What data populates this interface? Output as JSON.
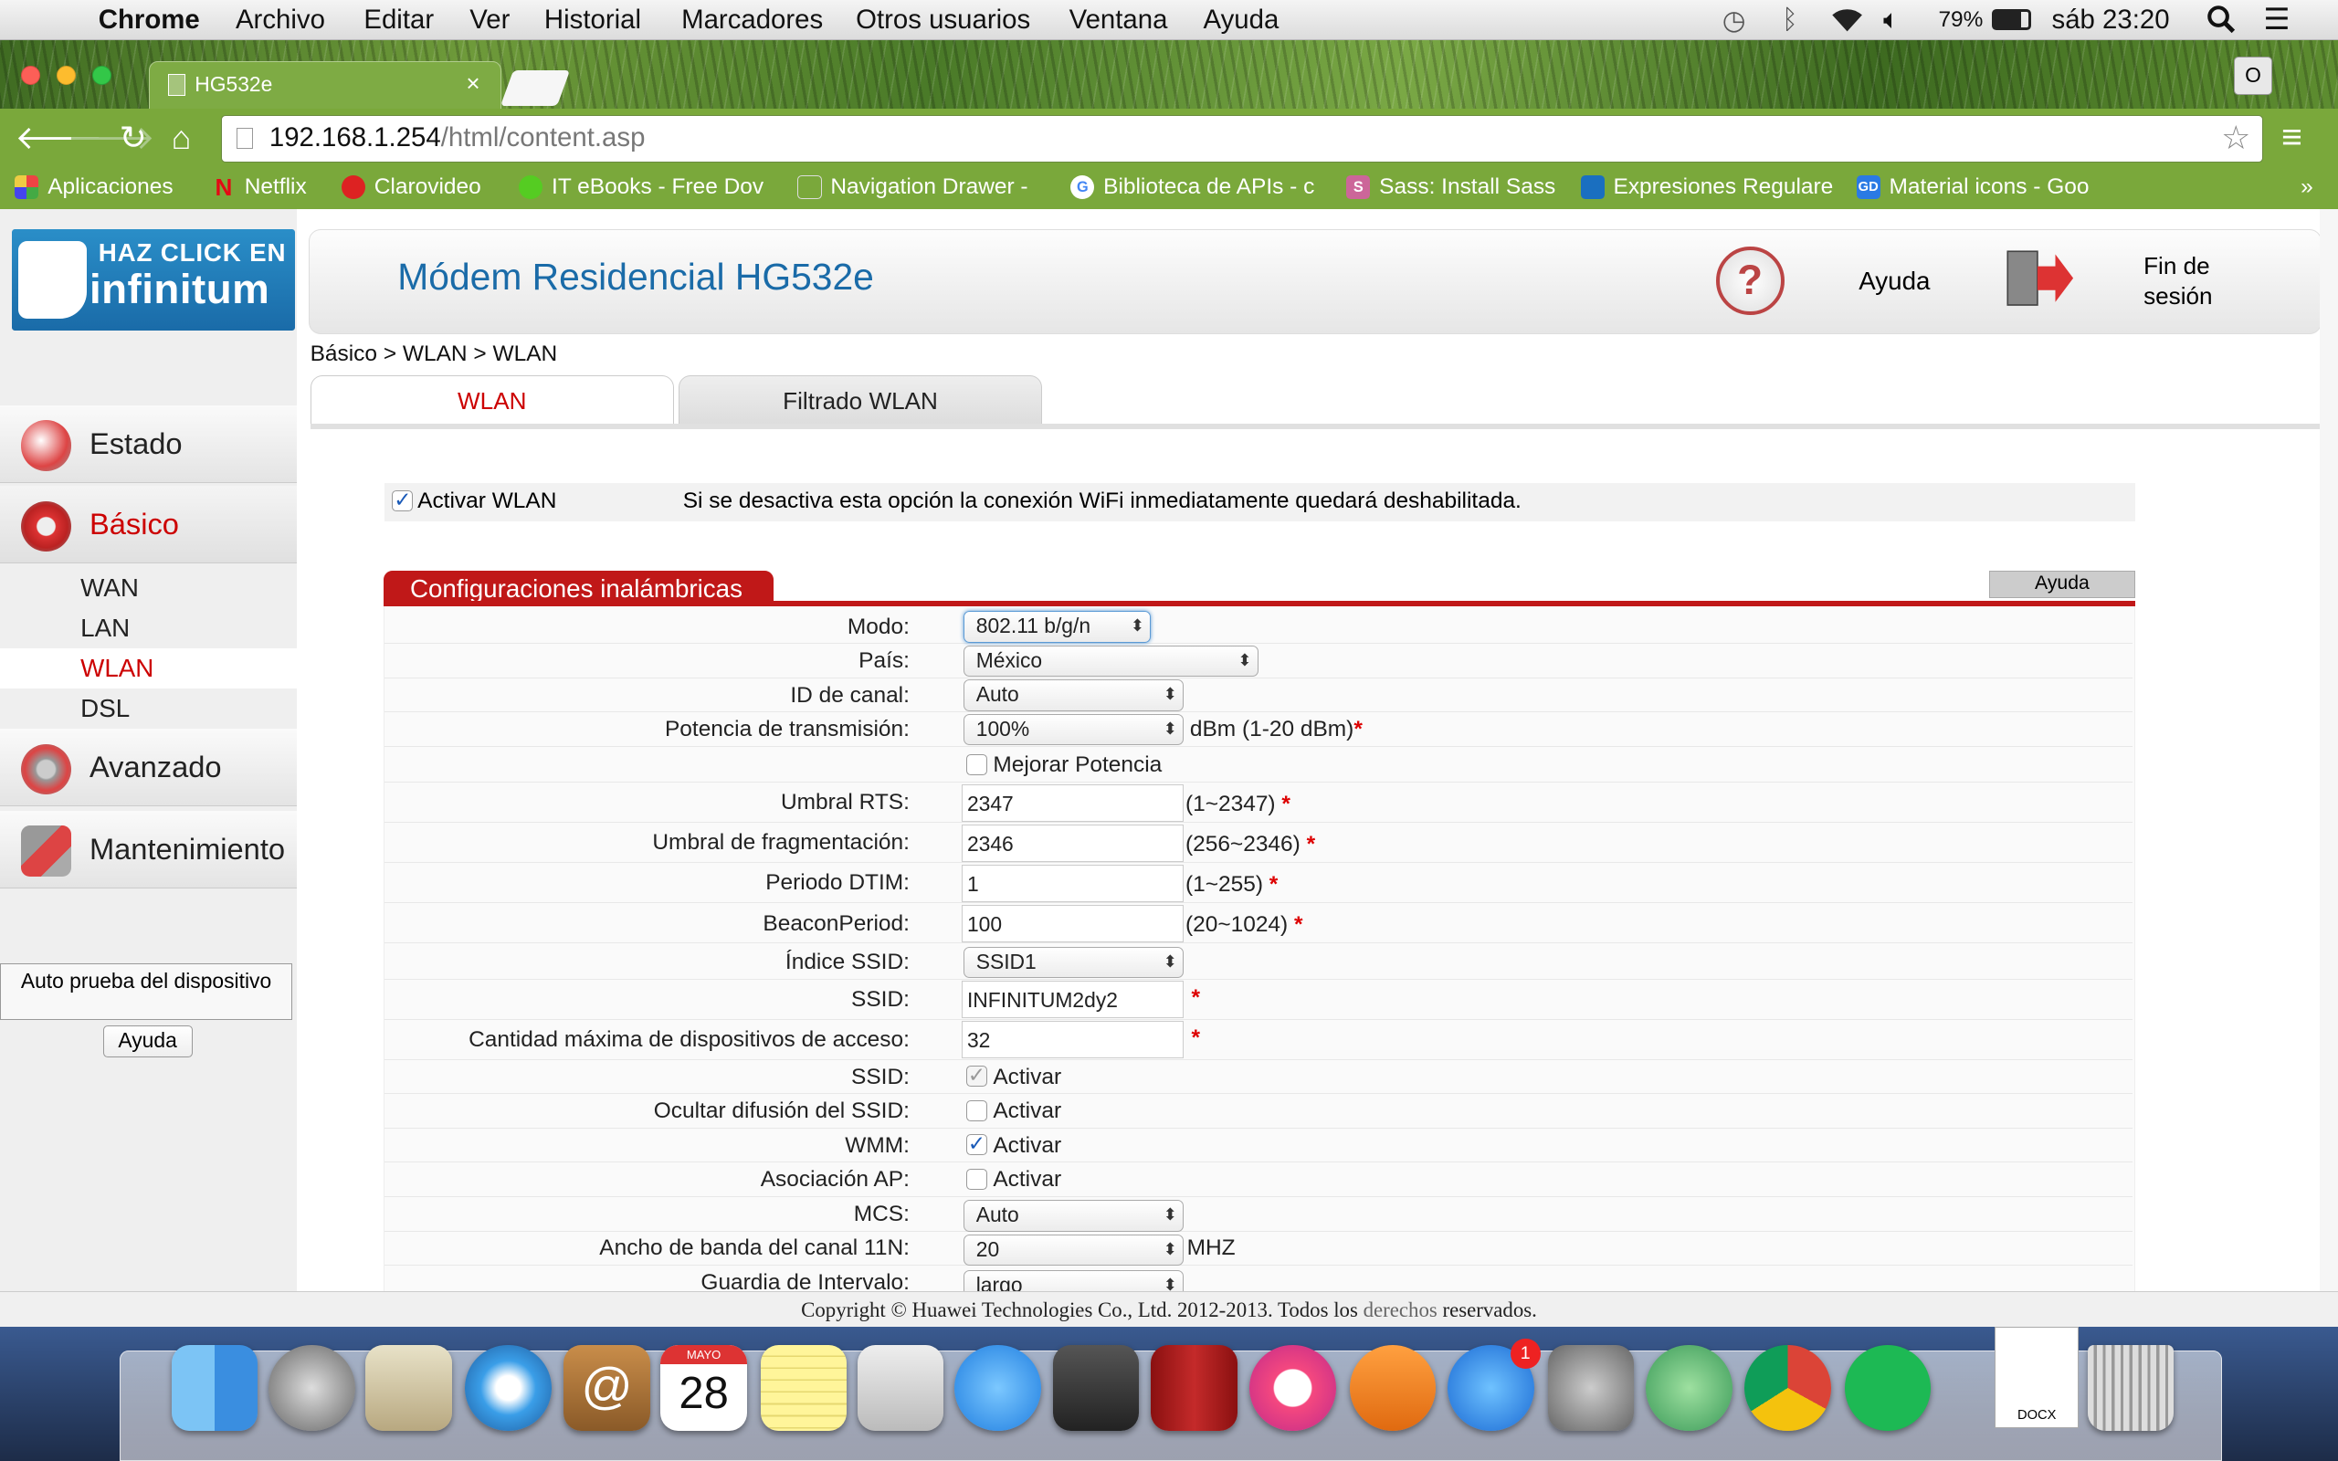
{
  "menubar": {
    "app": "Chrome",
    "items": [
      "Archivo",
      "Editar",
      "Ver",
      "Historial",
      "Marcadores",
      "Otros usuarios",
      "Ventana",
      "Ayuda"
    ],
    "battery": "79%",
    "clock": "sáb 23:20"
  },
  "browser": {
    "tab_title": "HG532e",
    "tab_close": "×",
    "profile": "O",
    "url_host": "192.168.1.254",
    "url_path": "/html/content.asp",
    "bookmarks": [
      "Aplicaciones",
      "Netflix",
      "Clarovideo",
      "IT eBooks - Free Dov",
      "Navigation Drawer -",
      "Biblioteca de APIs - c",
      "Sass: Install Sass",
      "Expresiones Regulare",
      "Material icons - Goo"
    ],
    "bookmarks_more": "»"
  },
  "logo": {
    "line1": "HAZ CLICK EN",
    "line2": "infinitum"
  },
  "header": {
    "title": "Módem Residencial HG532e",
    "help": "Ayuda",
    "logout": "Fin de sesión"
  },
  "sidebar": {
    "estado": "Estado",
    "basico": "Básico",
    "sub": [
      "WAN",
      "LAN",
      "WLAN",
      "DSL"
    ],
    "avanzado": "Avanzado",
    "mantenimiento": "Mantenimiento",
    "autotest": "Auto prueba del dispositivo",
    "help": "Ayuda"
  },
  "breadcrumb": "Básico > WLAN > WLAN",
  "tabs": [
    "WLAN",
    "Filtrado WLAN"
  ],
  "wlan": {
    "enable_label": "Activar WLAN",
    "enable_note": "Si se desactiva esta opción la conexión WiFi inmediatamente quedará deshabilitada."
  },
  "section": {
    "title": "Configuraciones inalámbricas",
    "help": "Ayuda"
  },
  "form": {
    "mode_label": "Modo:",
    "mode": "802.11 b/g/n",
    "country_label": "País:",
    "country": "México",
    "channel_label": "ID de canal:",
    "channel": "Auto",
    "power_label": "Potencia de transmisión:",
    "power": "100%",
    "power_unit": "dBm (1-20 dBm)",
    "boost_label": "Mejorar Potencia",
    "rts_label": "Umbral RTS:",
    "rts": "2347",
    "rts_range": "(1~2347)",
    "frag_label": "Umbral de fragmentación:",
    "frag": "2346",
    "frag_range": "(256~2346)",
    "dtim_label": "Periodo DTIM:",
    "dtim": "1",
    "dtim_range": "(1~255)",
    "beacon_label": "BeaconPeriod:",
    "beacon": "100",
    "beacon_range": "(20~1024)",
    "ssid_index_label": "Índice SSID:",
    "ssid_index": "SSID1",
    "ssid_label": "SSID:",
    "ssid": "INFINITUM2dy2",
    "maxdev_label": "Cantidad máxima de dispositivos de acceso:",
    "maxdev": "32",
    "ssid_enable_label": "SSID:",
    "activate": "Activar",
    "hide_label": "Ocultar difusión del SSID:",
    "wmm_label": "WMM:",
    "ap_label": "Asociación AP:",
    "mcs_label": "MCS:",
    "mcs": "Auto",
    "bw_label": "Ancho de banda del canal 11N:",
    "bw": "20",
    "bw_unit": "MHZ",
    "gi_label": "Guardia de Intervalo:",
    "gi": "largo",
    "required_mark": "*"
  },
  "footer": {
    "pre": "Copyright © Huawei Technologies Co., Ltd. 2012-2013. Todos los ",
    "link": "derechos",
    "post": " reservados."
  },
  "dock": {
    "calendar_month": "MAYO",
    "calendar_day": "28",
    "appstore_badge": "1",
    "docx": "DOCX"
  }
}
